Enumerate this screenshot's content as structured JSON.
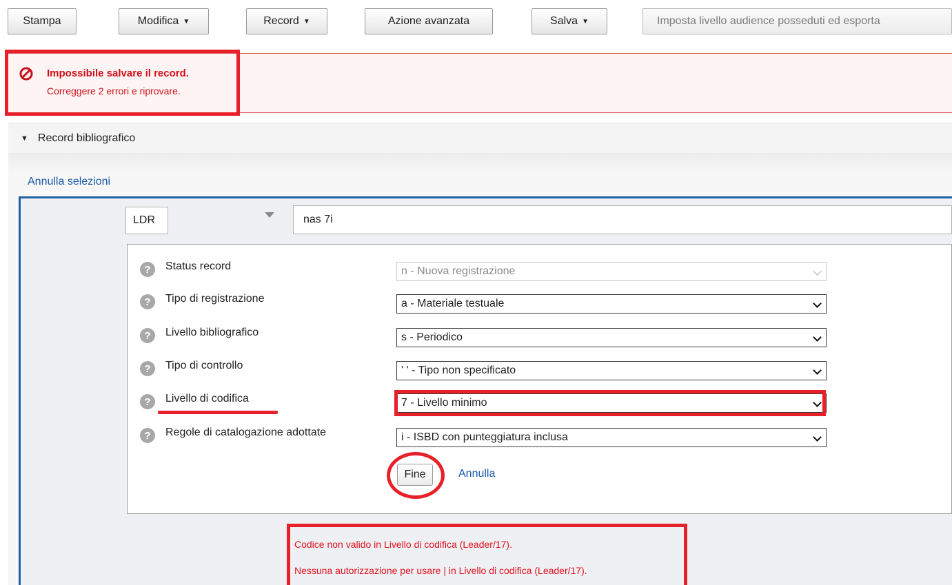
{
  "toolbar": {
    "stampa": "Stampa",
    "modifica": "Modifica",
    "record": "Record",
    "azione_avanzata": "Azione avanzata",
    "salva": "Salva",
    "imposta": "Imposta livello audience posseduti ed esporta"
  },
  "error": {
    "title": "Impossibile salvare il record.",
    "subtitle": "Correggere 2 errori e riprovare."
  },
  "section": {
    "title": "Record bibliografico",
    "annulla_selezioni": "Annulla selezioni"
  },
  "leader": {
    "tag": "LDR",
    "value": "nas  7i"
  },
  "fields": [
    {
      "label": "Status record",
      "value": "n - Nuova registrazione",
      "disabled": true
    },
    {
      "label": "Tipo di registrazione",
      "value": "a - Materiale testuale"
    },
    {
      "label": "Livello bibliografico",
      "value": "s - Periodico"
    },
    {
      "label": "Tipo di controllo",
      "value": "' ' - Tipo non specificato"
    },
    {
      "label": "Livello di codifica",
      "value": "7 - Livello minimo"
    },
    {
      "label": "Regole di catalogazione adottate",
      "value": "i - ISBD con punteggiatura inclusa"
    }
  ],
  "actions": {
    "fine": "Fine",
    "annulla": "Annulla"
  },
  "messages": [
    "Codice non valido in Livello di codifica (Leader/17).",
    "Nessuna autorizzazione per usare | in Livello di codifica (Leader/17)."
  ],
  "colors": {
    "error": "#d0101a",
    "highlight": "#e8202a",
    "link": "#1a5aa8",
    "editor_border": "#1f5fa6"
  }
}
